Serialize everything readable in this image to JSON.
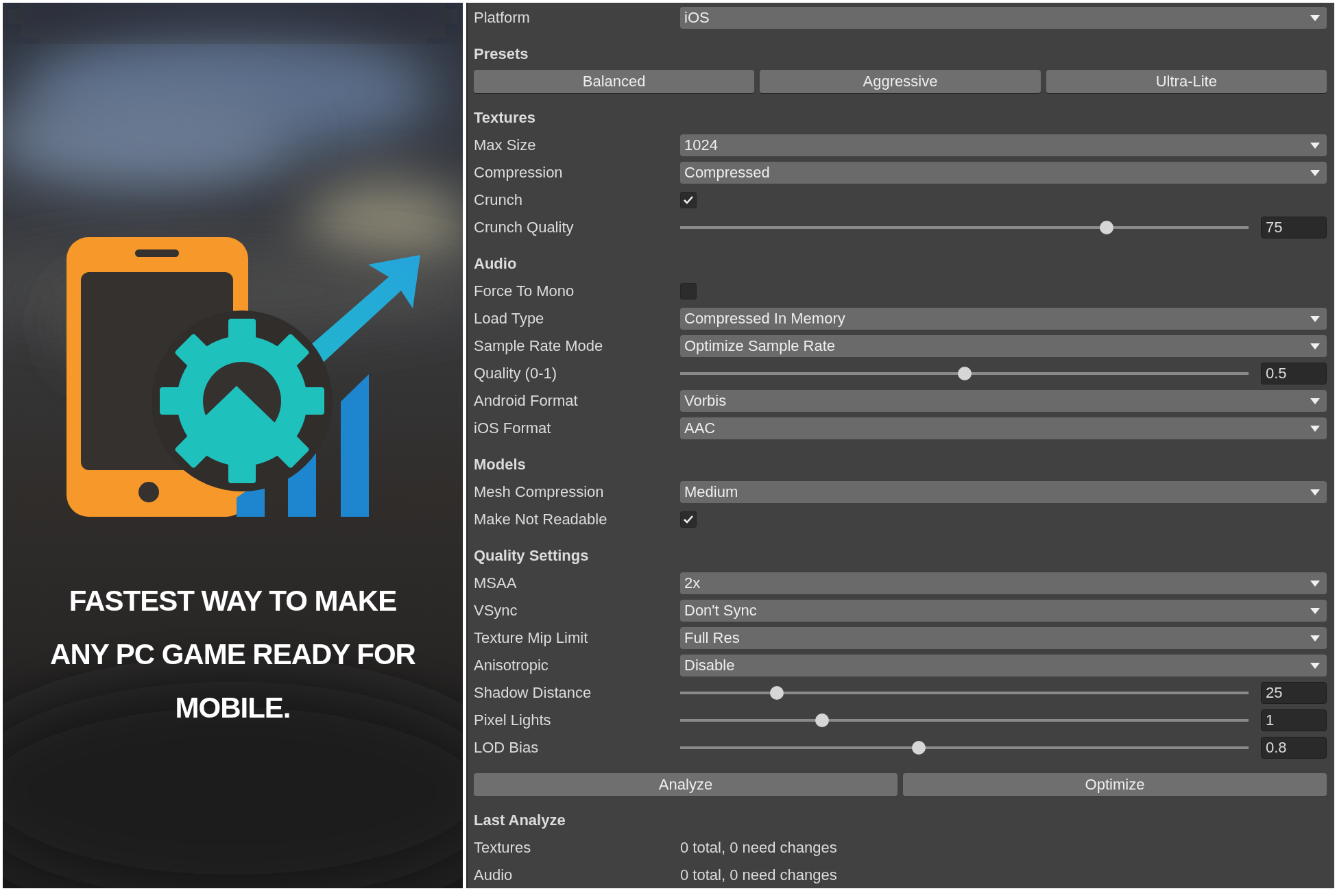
{
  "promo": {
    "kind": "picture",
    "tagline": "FASTEST WAY TO MAKE ANY PC GAME READY FOR MOBILE."
  },
  "platform": {
    "kind": "dropdown",
    "label": "Platform",
    "value": "iOS"
  },
  "presets": {
    "title": "Presets",
    "buttons": [
      "Balanced",
      "Aggressive",
      "Ultra-Lite"
    ]
  },
  "sections": [
    {
      "title": "Textures",
      "rows": [
        {
          "kind": "dropdown",
          "label": "Max Size",
          "value": "1024"
        },
        {
          "kind": "dropdown",
          "label": "Compression",
          "value": "Compressed"
        },
        {
          "kind": "checkbox",
          "label": "Crunch",
          "checked": true
        },
        {
          "kind": "slider",
          "label": "Crunch Quality",
          "level": 0.75,
          "value": "75"
        }
      ]
    },
    {
      "title": "Audio",
      "rows": [
        {
          "kind": "checkbox",
          "label": "Force To Mono",
          "checked": false
        },
        {
          "kind": "dropdown",
          "label": "Load Type",
          "value": "Compressed In Memory"
        },
        {
          "kind": "dropdown",
          "label": "Sample Rate Mode",
          "value": "Optimize Sample Rate"
        },
        {
          "kind": "slider",
          "label": "Quality (0-1)",
          "level": 0.5,
          "value": "0.5"
        },
        {
          "kind": "dropdown",
          "label": "Android Format",
          "value": "Vorbis"
        },
        {
          "kind": "dropdown",
          "label": "iOS Format",
          "value": "AAC"
        }
      ]
    },
    {
      "title": "Models",
      "rows": [
        {
          "kind": "dropdown",
          "label": "Mesh Compression",
          "value": "Medium"
        },
        {
          "kind": "checkbox",
          "label": "Make Not Readable",
          "checked": true
        }
      ]
    },
    {
      "title": "Quality Settings",
      "rows": [
        {
          "kind": "dropdown",
          "label": "MSAA",
          "value": "2x"
        },
        {
          "kind": "dropdown",
          "label": "VSync",
          "value": "Don't Sync"
        },
        {
          "kind": "dropdown",
          "label": "Texture Mip Limit",
          "value": "Full Res"
        },
        {
          "kind": "dropdown",
          "label": "Anisotropic",
          "value": "Disable"
        },
        {
          "kind": "slider",
          "label": "Shadow Distance",
          "level": 0.17,
          "value": "25"
        },
        {
          "kind": "slider",
          "label": "Pixel Lights",
          "level": 0.25,
          "value": "1"
        },
        {
          "kind": "slider",
          "label": "LOD Bias",
          "level": 0.42,
          "value": "0.8"
        }
      ]
    }
  ],
  "actions": [
    "Analyze",
    "Optimize"
  ],
  "last_analyze": {
    "title": "Last Analyze",
    "rows": [
      {
        "label": "Textures",
        "value": "0 total, 0 need changes"
      },
      {
        "label": "Audio",
        "value": "0 total, 0 need changes"
      }
    ]
  }
}
